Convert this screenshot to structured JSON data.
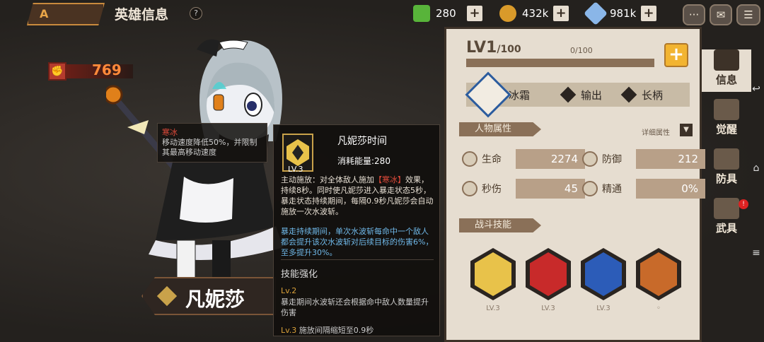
{
  "header": {
    "back_label": "A",
    "title": "英雄信息",
    "help_label": "?"
  },
  "resources": [
    {
      "name": "green-gem",
      "value": "280",
      "plus": "+",
      "color": "#58b43a"
    },
    {
      "name": "gold-coin",
      "value": "432k",
      "plus": "+",
      "color": "#d99a2a"
    },
    {
      "name": "crystal",
      "value": "981k",
      "plus": "+",
      "color": "#8ab6e8"
    }
  ],
  "top_buttons": {
    "chat": "···",
    "mail": "✉",
    "menu": "☰"
  },
  "hero": {
    "power": "769",
    "name": "凡妮莎"
  },
  "status_tip": {
    "name": "寒冰",
    "desc": "移动速度降低50%，并限制其最高移动速度"
  },
  "skill_popup": {
    "level": "LV.3",
    "title": "凡妮莎时间",
    "cost": "消耗能量:280",
    "body_prefix": "主动施放：对全体敌人施加",
    "body_highlight": "【寒冰】",
    "body_suffix": "效果，持续8秒。同时使凡妮莎进入暴走状态5秒，暴走状态持续期间，每隔0.9秒凡妮莎会自动施放一次水波斩。",
    "body_blue": "暴走持续期间，单次水波斩每命中一个敌人都会提升该次水波斩对后续目标的伤害6%，至多提升30%。",
    "enhance_title": "技能强化",
    "lv2_label": "Lv.2",
    "lv2_desc": "暴走期间水波斩还会根据命中敌人数量提升伤害",
    "lv3_label": "Lv.3",
    "lv3_desc": "施放间隔缩短至0.9秒"
  },
  "panel": {
    "level": "LV1",
    "level_max": "/100",
    "exp_text": "0/100",
    "exp_fraction": 0,
    "plus": "+",
    "tags": [
      "冰霜",
      "输出",
      "长柄"
    ],
    "attr_title": "人物属性",
    "detail_link": "详细属性",
    "stats": [
      {
        "label": "生命",
        "value": "2274"
      },
      {
        "label": "防御",
        "value": "212"
      },
      {
        "label": "秒伤",
        "value": "45"
      },
      {
        "label": "精通",
        "value": "0%"
      }
    ],
    "skills_title": "战斗技能",
    "skills": [
      {
        "name": "vanessa-time",
        "level": "LV.3",
        "color": "#e8c24a"
      },
      {
        "name": "water-slash",
        "level": "LV.3",
        "color": "#c82a2a"
      },
      {
        "name": "ice-burst",
        "level": "LV.3",
        "color": "#2c5cb8"
      },
      {
        "name": "polearm",
        "level": "",
        "color": "#c86a2a"
      }
    ]
  },
  "side_tabs": [
    {
      "label": "信息",
      "active": true
    },
    {
      "label": "觉醒"
    },
    {
      "label": "防具"
    },
    {
      "label": "武具",
      "badge": "!"
    }
  ]
}
